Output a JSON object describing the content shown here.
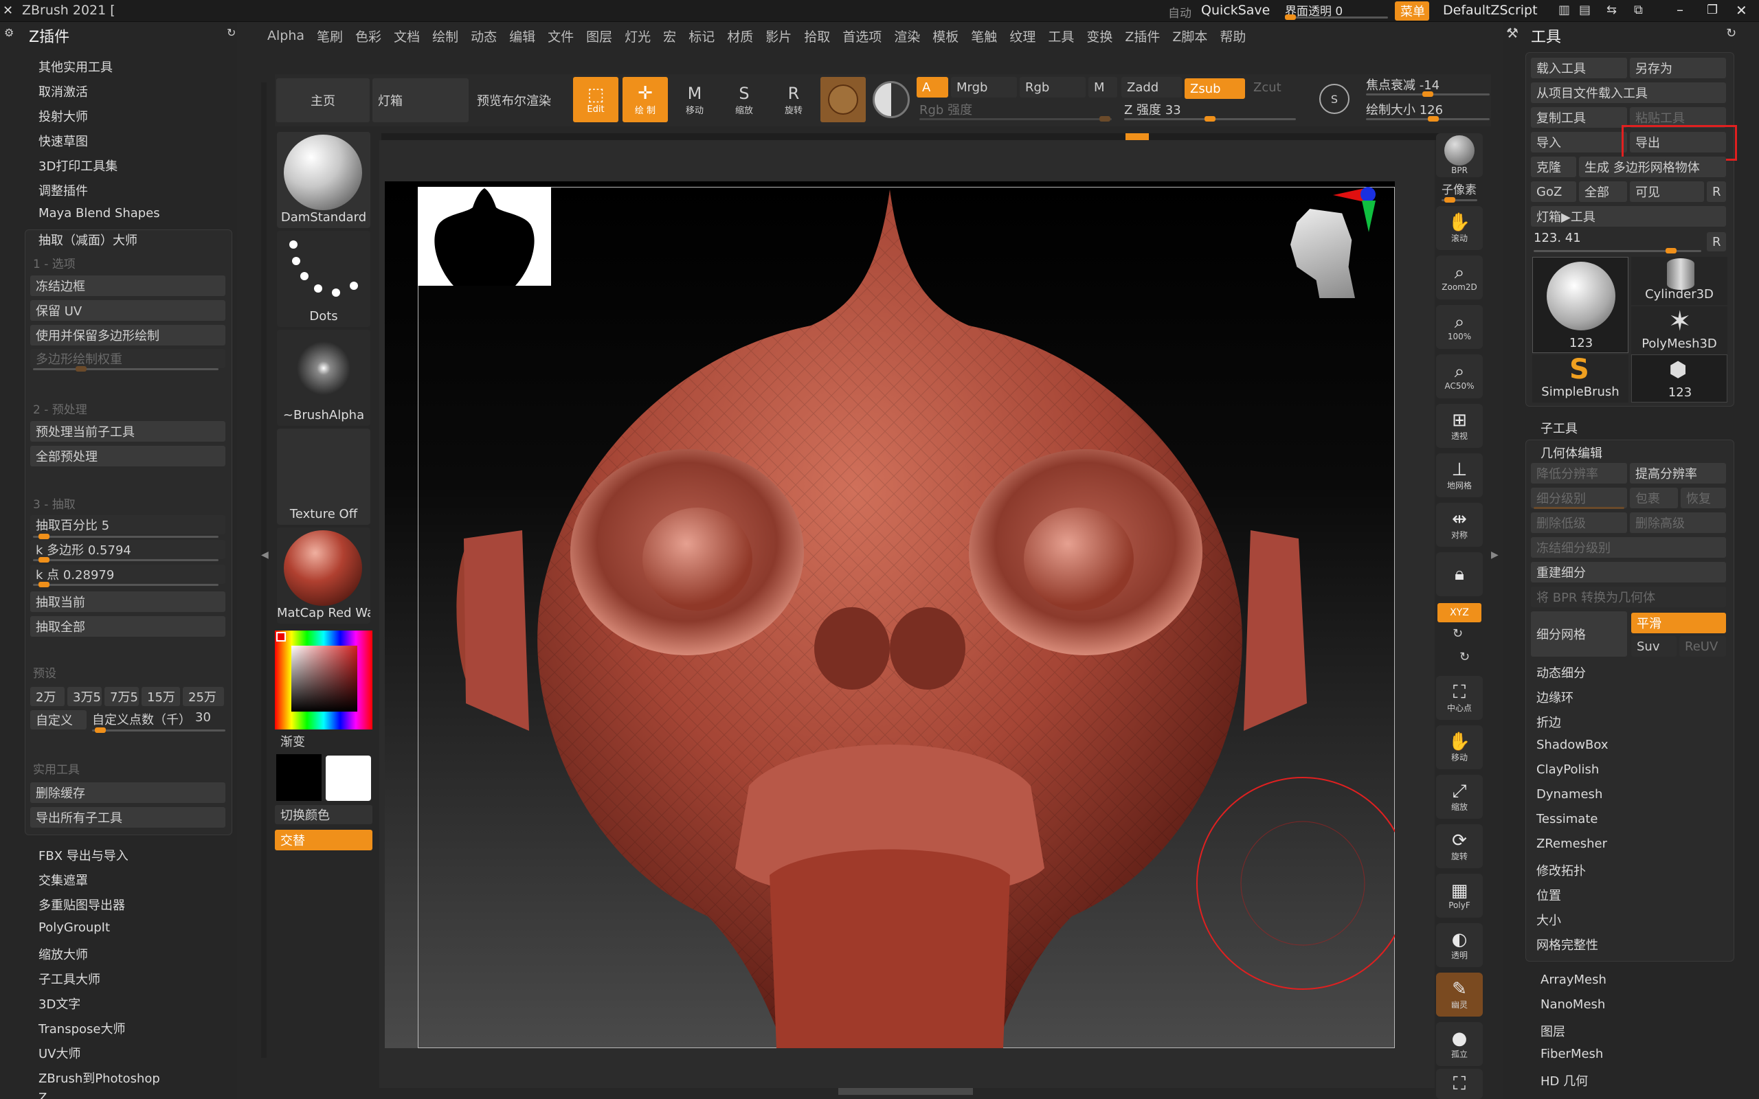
{
  "titlebar": {
    "app_title": "ZBrush 2021 [",
    "auto_label": "自动",
    "quicksave": "QuickSave",
    "ui_transparency": "界面透明 0",
    "menu_btn": "菜单",
    "script": "DefaultZScript"
  },
  "menubar": [
    "Alpha",
    "笔刷",
    "色彩",
    "文档",
    "绘制",
    "动态",
    "编辑",
    "文件",
    "图层",
    "灯光",
    "宏",
    "标记",
    "材质",
    "影片",
    "拾取",
    "首选项",
    "渲染",
    "模板",
    "笔触",
    "纹理",
    "工具",
    "变换",
    "Z插件",
    "Z脚本",
    "帮助"
  ],
  "left_panel": {
    "title": "Z插件",
    "top_items": [
      "其他实用工具",
      "取消激活",
      "投射大师",
      "快速草图",
      "3D打印工具集",
      "调整插件",
      "Maya Blend Shapes"
    ],
    "decimation": {
      "title": "抽取（减面）大师",
      "sec1": "1 - 选项",
      "freeze_borders": "冻结边框",
      "keep_uv": "保留 UV",
      "use_polypaint": "使用并保留多边形绘制",
      "polypaint_weight": "多边形绘制权重",
      "sec2": "2 - 预处理",
      "preprocess_current": "预处理当前子工具",
      "preprocess_all": "全部预处理",
      "sec3": "3 - 抽取",
      "decimation_pct": "抽取百分比 5",
      "kpolys": "k 多边形 0.5794",
      "kpoints": "k 点 0.28979",
      "decimate_current": "抽取当前",
      "decimate_all": "抽取全部",
      "presets_label": "预设",
      "presets": [
        "2万",
        "3万5",
        "7万5",
        "15万",
        "25万"
      ],
      "custom": "自定义",
      "custom_points": "自定义点数（千）",
      "custom_value": "30",
      "utilities": "实用工具",
      "delete_cache": "删除缓存",
      "export_all": "导出所有子工具"
    },
    "bottom_items": [
      "FBX 导出与导入",
      "交集遮罩",
      "多重贴图导出器",
      "PolyGroupIt",
      "缩放大师",
      "子工具大师",
      "3D文字",
      "Transpose大师",
      "UV大师",
      "ZBrush到Photoshop",
      "Z..."
    ]
  },
  "top_shelf": {
    "home": "主页",
    "lightbox": "灯箱",
    "bpr_preview": "预览布尔渲染",
    "edit": "Edit",
    "draw": "绘 制",
    "move": "移动",
    "scale": "缩放",
    "rotate": "旋转",
    "a": "A",
    "mrgb": "Mrgb",
    "rgb": "Rgb",
    "m": "M",
    "zadd": "Zadd",
    "zsub": "Zsub",
    "zcut": "Zcut",
    "rgb_intensity": "Rgb 强度",
    "z_intensity": "Z 强度 33",
    "focal_shift": "焦点衰减 -14",
    "draw_size": "绘制大小 126",
    "focal_knob": 0.5,
    "draw_size_knob": 0.55,
    "z_intensity_knob": 0.5
  },
  "palette": {
    "brush": "DamStandard",
    "stroke": "Dots",
    "alpha": "~BrushAlpha",
    "texture": "Texture Off",
    "material": "MatCap Red Wax",
    "gradient": "渐变",
    "switch_color": "切换颜色",
    "alternate": "交替"
  },
  "right_vtoolbar": [
    "BPR",
    "子像素",
    "滚动",
    "Zoom2D",
    "100%",
    "AC50%",
    "透视",
    "地网格",
    "对称",
    "锁",
    "XYZ",
    "中心点",
    "移动",
    "缩放",
    "旋转",
    "PolyF",
    "透明",
    "幽灵",
    "孤立",
    "全屏"
  ],
  "right_panel": {
    "title": "工具",
    "load_tool": "载入工具",
    "save_as": "另存为",
    "load_from_project": "从项目文件载入工具",
    "copy_tool": "复制工具",
    "paste_tool": "粘贴工具",
    "import": "导入",
    "export": "导出",
    "clone": "克隆",
    "make_polymesh": "生成 多边形网格物体",
    "goz": "GoZ",
    "all": "全部",
    "visible": "可见",
    "r": "R",
    "lightbox_tools": "灯箱▶工具",
    "tool_value": "123. 41",
    "thumbs": [
      "123",
      "Cylinder3D",
      "PolyMesh3D",
      "SimpleBrush",
      "123"
    ],
    "subtool": "子工具",
    "geometry": "几何体编辑",
    "lower_res": "降低分辨率",
    "higher_res": "提高分辨率",
    "sdiv": "细分级别",
    "cage": "包裹",
    "restore": "恢复",
    "del_lower": "删除低级",
    "del_higher": "删除高级",
    "freeze_sdiv": "冻结细分级别",
    "reconstruct": "重建细分",
    "bpr_to_geo": "将 BPR 转换为几何体",
    "divide": "细分网格",
    "smooth": "平滑",
    "suv": "Suv",
    "reuv": "ReUV",
    "list": [
      "动态细分",
      "边缘环",
      "折边",
      "ShadowBox",
      "ClayPolish",
      "Dynamesh",
      "Tessimate",
      "ZRemesher",
      "修改拓扑",
      "位置",
      "大小",
      "网格完整性"
    ],
    "after": [
      "ArrayMesh",
      "NanoMesh",
      "图层",
      "FiberMesh",
      "HD 几何"
    ]
  },
  "colors": {
    "accent": "#f0901a",
    "mesh": "#b34a3a",
    "highlight_box": "#e02020"
  }
}
